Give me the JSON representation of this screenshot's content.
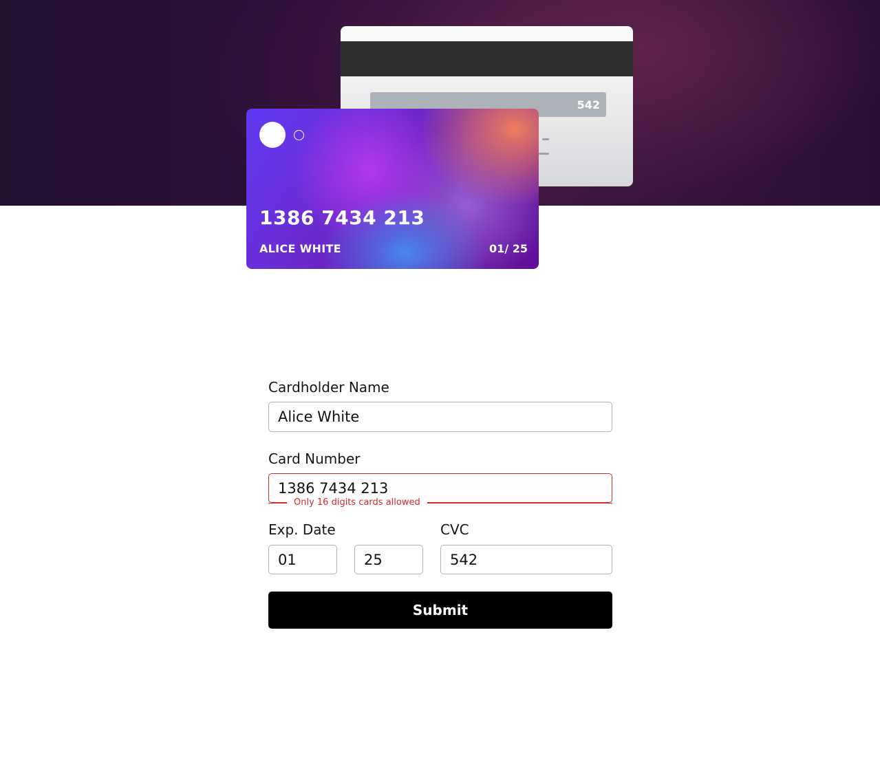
{
  "card_preview": {
    "number": "1386 7434 213",
    "holder": "ALICE WHITE",
    "expiry": "01/ 25",
    "cvc": "542"
  },
  "form": {
    "name_label": "Cardholder Name",
    "name_value": "Alice White",
    "number_label": "Card Number",
    "number_value": "1386 7434 213",
    "number_error": "Only 16 digits cards allowed",
    "exp_label": "Exp. Date",
    "exp_month_value": "01",
    "exp_year_value": "25",
    "cvc_label": "CVC",
    "cvc_value": "542",
    "submit_label": "Submit"
  },
  "colors": {
    "error": "#d12a2a",
    "button_bg": "#000000",
    "hero_bg": "#2d1038"
  }
}
